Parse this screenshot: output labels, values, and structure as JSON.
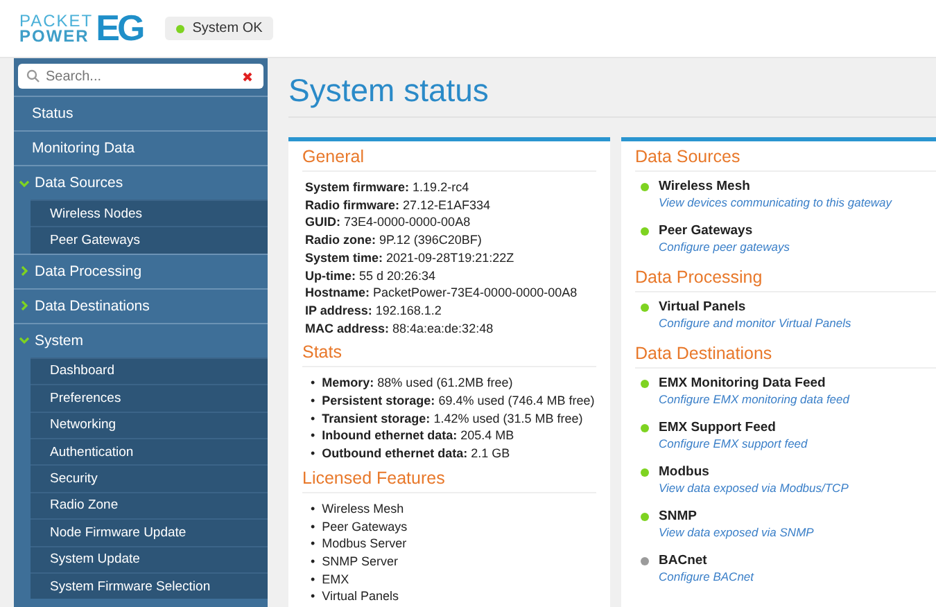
{
  "logo": {
    "line_1": "PACKET",
    "line_2": "POWER",
    "mark": "EG"
  },
  "status_badge": {
    "label": "System OK",
    "color": "#7ed321"
  },
  "search": {
    "placeholder": "Search..."
  },
  "sidebar": {
    "items": [
      {
        "label": "Status",
        "kind": "link"
      },
      {
        "label": "Monitoring Data",
        "kind": "link"
      },
      {
        "label": "Data Sources",
        "kind": "group",
        "expanded": true,
        "children": [
          {
            "label": "Wireless Nodes"
          },
          {
            "label": "Peer Gateways"
          }
        ]
      },
      {
        "label": "Data Processing",
        "kind": "group",
        "expanded": false
      },
      {
        "label": "Data Destinations",
        "kind": "group",
        "expanded": false
      },
      {
        "label": "System",
        "kind": "group",
        "expanded": true,
        "children": [
          {
            "label": "Dashboard"
          },
          {
            "label": "Preferences"
          },
          {
            "label": "Networking"
          },
          {
            "label": "Authentication"
          },
          {
            "label": "Security"
          },
          {
            "label": "Radio Zone"
          },
          {
            "label": "Node Firmware Update"
          },
          {
            "label": "System Update"
          },
          {
            "label": "System Firmware Selection"
          }
        ]
      }
    ]
  },
  "page_title": "System status",
  "general": {
    "title": "General",
    "fields": [
      {
        "label": "System firmware:",
        "value": "1.19.2-rc4"
      },
      {
        "label": "Radio firmware:",
        "value": "27.12-E1AF334"
      },
      {
        "label": "GUID:",
        "value": "73E4-0000-0000-00A8"
      },
      {
        "label": "Radio zone:",
        "value": "9P.12 (396C20BF)"
      },
      {
        "label": "System time:",
        "value": "2021-09-28T19:21:22Z"
      },
      {
        "label": "Up-time:",
        "value": "55 d 20:26:34"
      },
      {
        "label": "Hostname:",
        "value": "PacketPower-73E4-0000-0000-00A8"
      },
      {
        "label": "IP address:",
        "value": "192.168.1.2"
      },
      {
        "label": "MAC address:",
        "value": "88:4a:ea:de:32:48"
      }
    ]
  },
  "stats": {
    "title": "Stats",
    "bullet": "•",
    "items": [
      {
        "label": "Memory:",
        "value": "88% used (61.2MB free)"
      },
      {
        "label": "Persistent storage:",
        "value": "69.4% used (746.4 MB free)"
      },
      {
        "label": "Transient storage:",
        "value": "1.42% used (31.5 MB free)"
      },
      {
        "label": "Inbound ethernet data:",
        "value": "205.4 MB"
      },
      {
        "label": "Outbound ethernet data:",
        "value": "2.1 GB"
      }
    ]
  },
  "licensed_features": {
    "title": "Licensed Features",
    "bullet": "•",
    "items": [
      "Wireless Mesh",
      "Peer Gateways",
      "Modbus Server",
      "SNMP Server",
      "EMX",
      "Virtual Panels"
    ]
  },
  "services": [
    {
      "title": "Data Sources",
      "items": [
        {
          "name": "Wireless Mesh",
          "link": "View devices communicating to this gateway",
          "color": "#7ed321"
        },
        {
          "name": "Peer Gateways",
          "link": "Configure peer gateways",
          "color": "#7ed321"
        }
      ]
    },
    {
      "title": "Data Processing",
      "items": [
        {
          "name": "Virtual Panels",
          "link": "Configure and monitor Virtual Panels",
          "color": "#7ed321"
        }
      ]
    },
    {
      "title": "Data Destinations",
      "items": [
        {
          "name": "EMX Monitoring Data Feed",
          "link": "Configure EMX monitoring data feed",
          "color": "#7ed321"
        },
        {
          "name": "EMX Support Feed",
          "link": "Configure EMX support feed",
          "color": "#7ed321"
        },
        {
          "name": "Modbus",
          "link": "View data exposed via Modbus/TCP",
          "color": "#7ed321"
        },
        {
          "name": "SNMP",
          "link": "View data exposed via SNMP",
          "color": "#7ed321"
        },
        {
          "name": "BACnet",
          "link": "Configure BACnet",
          "color": "#9b9b9b"
        }
      ]
    }
  ]
}
